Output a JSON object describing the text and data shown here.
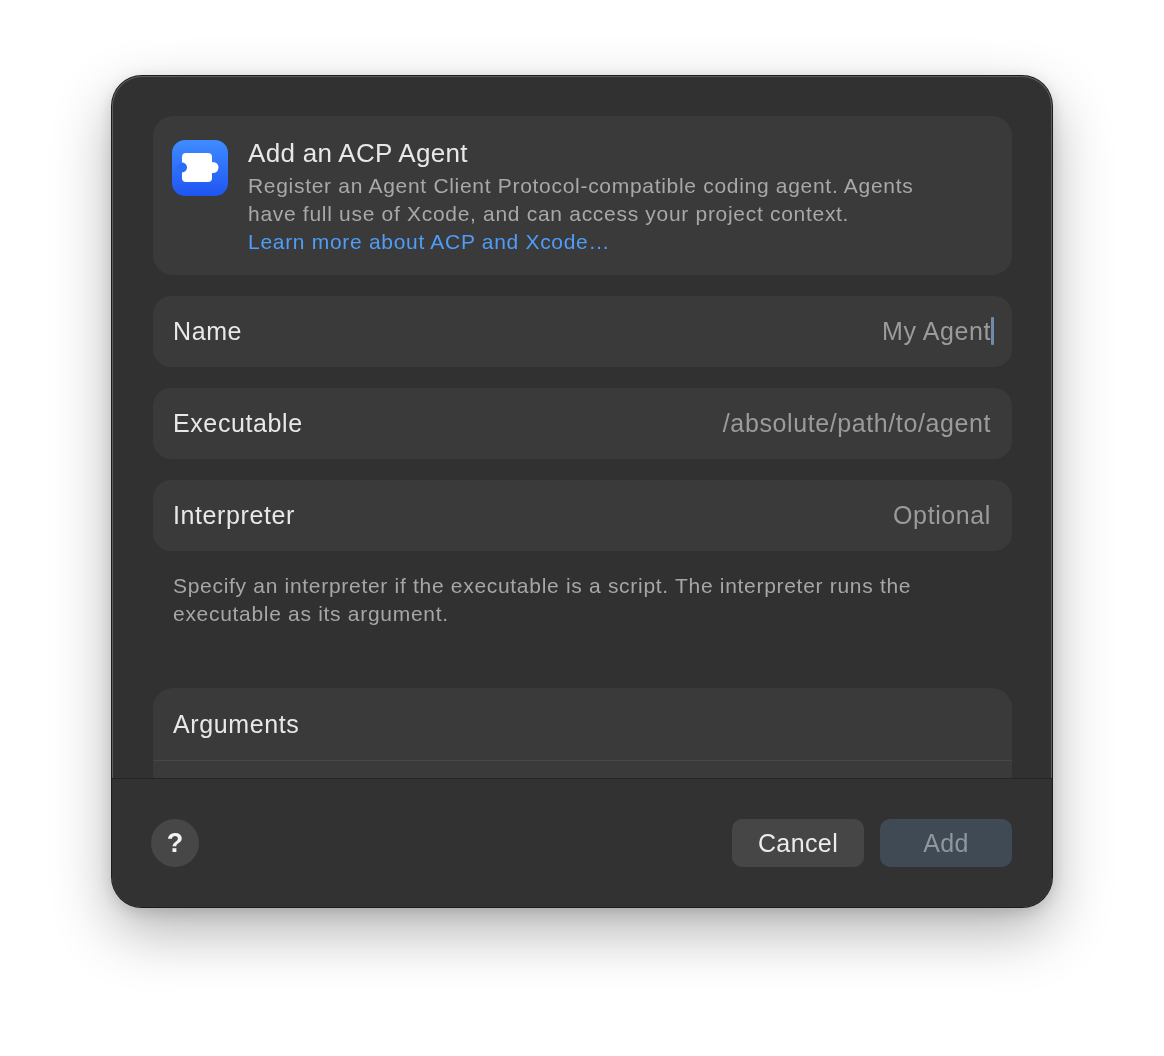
{
  "dialog": {
    "header": {
      "title": "Add an ACP Agent",
      "description": "Register an Agent Client Protocol-compatible coding agent. Agents have full use of Xcode, and can access your project context.",
      "link": "Learn more about ACP and Xcode…"
    },
    "fields": [
      {
        "label": "Name",
        "placeholder": "My Agent",
        "focused": true
      },
      {
        "label": "Executable",
        "placeholder": "/absolute/path/to/agent",
        "focused": false
      },
      {
        "label": "Interpreter",
        "placeholder": "Optional",
        "focused": false
      }
    ],
    "hint": "Specify an interpreter if the executable is a script. The interpreter runs the executable as its argument.",
    "arguments": {
      "title": "Arguments"
    },
    "footer": {
      "help_button": "?",
      "buttons": [
        {
          "label": "Cancel",
          "kind": "secondary",
          "disabled": false
        },
        {
          "label": "Add",
          "kind": "primary",
          "disabled": true
        }
      ]
    }
  }
}
